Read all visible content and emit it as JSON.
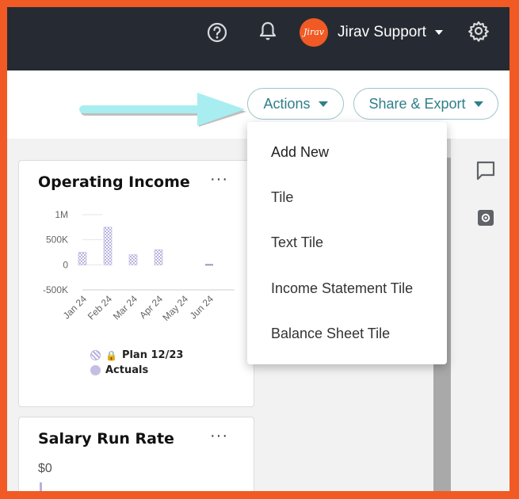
{
  "header": {
    "user_name": "Jirav Support",
    "avatar_text": "Jirav",
    "icons": [
      "help-icon",
      "bell-icon",
      "chevron-down-icon",
      "gear-icon"
    ]
  },
  "toolbar": {
    "actions_label": "Actions",
    "share_label": "Share & Export"
  },
  "actions_menu": {
    "items": [
      "Add New",
      "Tile",
      "Text Tile",
      "Income Statement Tile",
      "Balance Sheet Tile"
    ]
  },
  "cards": {
    "operating_income": {
      "title": "Operating Income",
      "more_label": "···",
      "legend": {
        "plan_label": "Plan 12/23",
        "actuals_label": "Actuals"
      }
    },
    "salary_run_rate": {
      "title": "Salary Run Rate",
      "more_label": "···",
      "value": "$0"
    }
  },
  "chart_data": {
    "type": "bar",
    "categories": [
      "Jan 24",
      "Feb 24",
      "Mar 24",
      "Apr 24",
      "May 24",
      "Jun 24"
    ],
    "y_tick_labels": [
      "1M",
      "500K",
      "0",
      "-500K"
    ],
    "ylim": [
      -500000,
      1000000
    ],
    "series": [
      {
        "name": "Plan 12/23",
        "values": [
          250000,
          750000,
          200000,
          300000,
          null,
          0
        ]
      },
      {
        "name": "Actuals",
        "values": [
          null,
          null,
          null,
          null,
          null,
          null
        ]
      }
    ],
    "legend_position": "bottom",
    "colors": {
      "plan": "#b6b2dd",
      "actuals": "#c2bfe3"
    }
  },
  "colors": {
    "accent": "#2f7f89",
    "frame": "#f15a24",
    "header_bg": "#262b33",
    "annotation_arrow": "#a8eef0"
  }
}
